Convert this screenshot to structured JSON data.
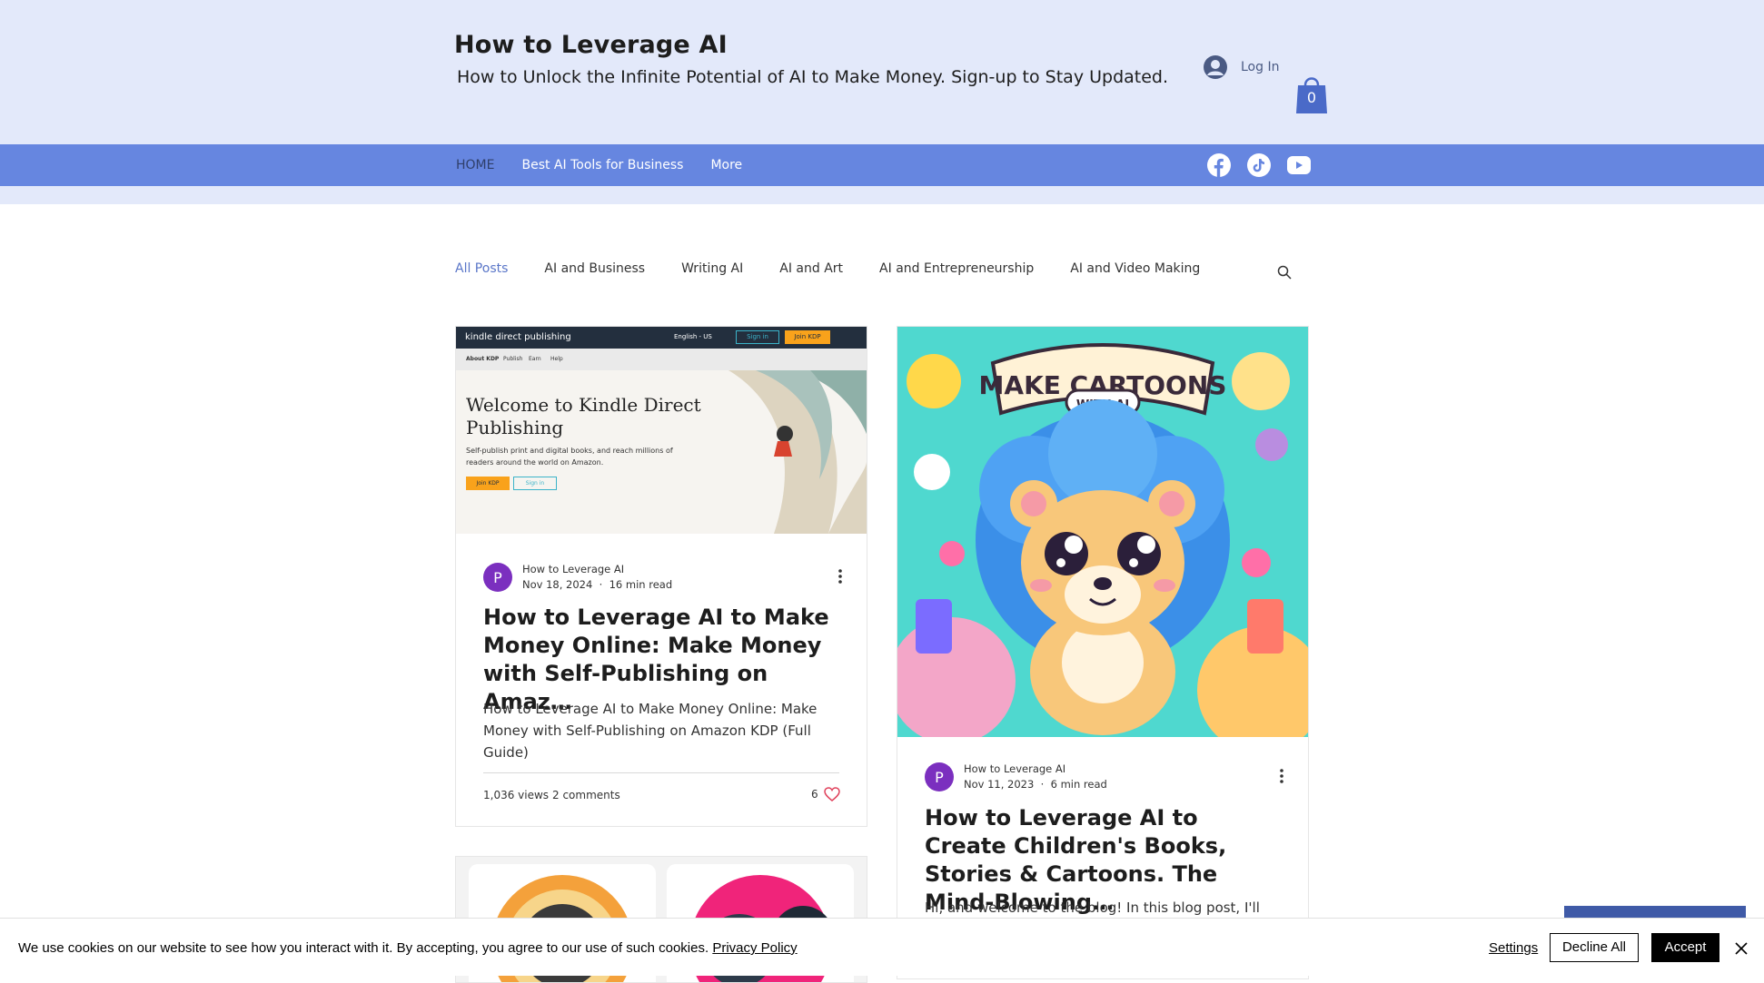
{
  "header": {
    "title": "How to Leverage AI",
    "subtitle": "How to Unlock the Infinite Potential of AI to Make Money. Sign-up to Stay Updated.",
    "login_label": "Log In",
    "cart_count": "0"
  },
  "nav": {
    "items": [
      {
        "label": "HOME"
      },
      {
        "label": "Best AI Tools for Business"
      },
      {
        "label": "More"
      }
    ],
    "socials": [
      "facebook-icon",
      "tiktok-icon",
      "youtube-icon"
    ]
  },
  "categories": [
    {
      "label": "All Posts"
    },
    {
      "label": "AI and Business"
    },
    {
      "label": "Writing AI"
    },
    {
      "label": "AI and Art"
    },
    {
      "label": "AI and Entrepreneurship"
    },
    {
      "label": "AI and Video Making"
    }
  ],
  "posts": [
    {
      "image": {
        "logo": "kindle direct publishing",
        "language": "English - US",
        "sign_in": "Sign in",
        "join": "Join KDP",
        "tabs": [
          "About KDP",
          "Publish",
          "Earn",
          "Help"
        ],
        "headline": "Welcome to Kindle Direct Publishing",
        "text": "Self-publish print and digital books, and reach millions of readers around the world on Amazon.",
        "btn_join": "Join KDP",
        "btn_sign": "Sign in"
      },
      "avatar": "P",
      "author": "How to Leverage AI",
      "date": "Nov 18, 2024",
      "read_time": "16 min read",
      "title": "How to Leverage AI to Make Money Online: Make Money with Self-Publishing on Amaz…",
      "excerpt": "How to Leverage AI to Make Money Online: Make Money with Self-Publishing on Amazon KDP (Full Guide)",
      "views": "1,036 views",
      "comments": "2 comments",
      "likes": "6"
    },
    {
      "image": {
        "banner": "MAKE CARTOONS",
        "banner_sub": "WITH AI"
      },
      "avatar": "P",
      "author": "How to Leverage AI",
      "date": "Nov 11, 2023",
      "read_time": "6 min read",
      "title": "How to Leverage AI to Create Children's Books, Stories & Cartoons. The Mind-Blowing…",
      "excerpt": "Hi, and welcome to the blog! In this blog post, I'll walk"
    }
  ],
  "cookie": {
    "text": "We use cookies on our website to see how you interact with it. By accepting, you agree to our use of such cookies.",
    "privacy": "Privacy Policy",
    "settings": "Settings",
    "decline": "Decline All",
    "accept": "Accept"
  },
  "colors": {
    "header_bg": "#e3e9fa",
    "nav_bg": "#6686e0",
    "accent": "#5a76c8",
    "avatar": "#7b2fbf"
  }
}
